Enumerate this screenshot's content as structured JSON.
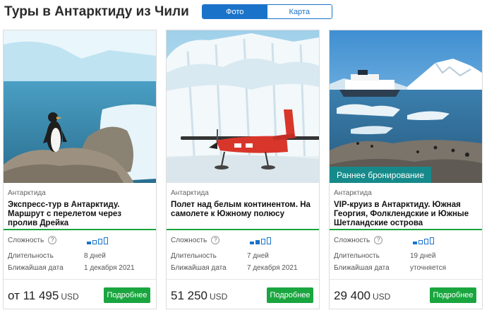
{
  "page_title": "Туры в Антарктиду из Чили",
  "view_toggle": {
    "photo": "Фото",
    "map": "Карта"
  },
  "labels": {
    "difficulty": "Сложность",
    "duration": "Длительность",
    "nearest_date": "Ближайшая дата",
    "more": "Подробнее",
    "currency": "USD",
    "help": "?"
  },
  "colors": {
    "accent_blue": "#1a73c9",
    "accent_green": "#1aa63f",
    "badge_teal": "#168a8a"
  },
  "cards": [
    {
      "region": "Антарктида",
      "title": "Экспресс-тур в Антарктиду. Маршрут с перелетом через пролив Дрейка",
      "difficulty_level": 1,
      "difficulty_max": 4,
      "duration": "8 дней",
      "date": "1 декабря 2021",
      "price": "от 11 495",
      "badge": ""
    },
    {
      "region": "Антарктида",
      "title": "Полет над белым континентом. На самолете к Южному полюсу",
      "difficulty_level": 2,
      "difficulty_max": 4,
      "duration": "7 дней",
      "date": "7 декабря 2021",
      "price": "51 250",
      "badge": ""
    },
    {
      "region": "Антарктида",
      "title": "VIP-круиз в Антарктиду. Южная Георгия, Фолклендские и Южные Шетландские острова",
      "difficulty_level": 1,
      "difficulty_max": 4,
      "duration": "19 дней",
      "date": "уточняется",
      "price": "29 400",
      "badge": "Раннее бронирование"
    }
  ]
}
